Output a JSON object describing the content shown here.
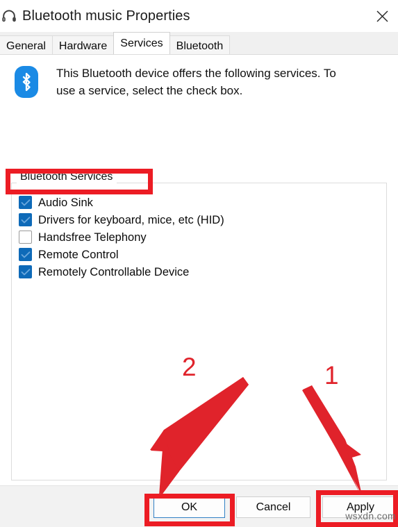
{
  "window": {
    "title": "Bluetooth music Properties",
    "icon": "headphones-icon",
    "close_label": "✕"
  },
  "tabs": [
    {
      "label": "General",
      "active": false
    },
    {
      "label": "Hardware",
      "active": false
    },
    {
      "label": "Services",
      "active": true
    },
    {
      "label": "Bluetooth",
      "active": false
    }
  ],
  "intro": {
    "icon": "bluetooth-icon",
    "text": "This Bluetooth device offers the following services. To use a service, select the check box."
  },
  "group": {
    "label": "Bluetooth Services",
    "services": [
      {
        "label": "Audio Sink",
        "checked": true
      },
      {
        "label": "Drivers for keyboard, mice, etc (HID)",
        "checked": true
      },
      {
        "label": "Handsfree Telephony",
        "checked": false
      },
      {
        "label": "Remote Control",
        "checked": true
      },
      {
        "label": "Remotely Controllable Device",
        "checked": true
      }
    ]
  },
  "footer": {
    "ok_label": "OK",
    "cancel_label": "Cancel",
    "apply_label": "Apply"
  },
  "annotations": {
    "step_one": "1",
    "step_two": "2",
    "highlight_color": "#ec1c24",
    "arrow_color": "#e0232b",
    "watermark": "wsxdn.com"
  }
}
